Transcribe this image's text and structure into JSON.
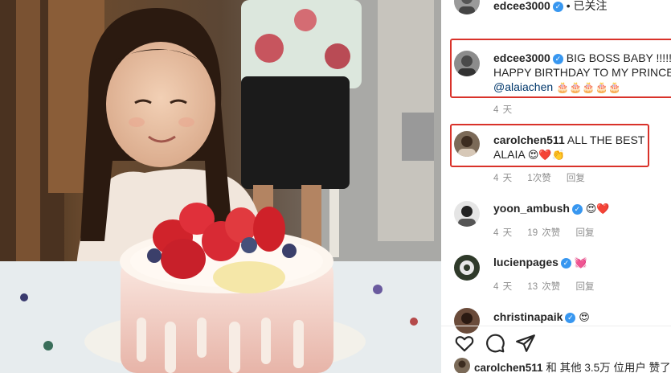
{
  "post": {
    "author": "edcee3000",
    "follow_status": "• 已关注"
  },
  "comments": [
    {
      "username": "edcee3000",
      "line1": "BIG BOSS BABY !!!!!",
      "line2": "HAPPY BIRTHDAY TO MY PRINCESS",
      "mention": "@alaiachen",
      "emojis": "🎂🎂🎂🎂🎂",
      "time": "4 天"
    },
    {
      "username": "carolchen511",
      "line1": "ALL THE BEST",
      "line2": "ALAIA",
      "emojis": "😍❤️👏",
      "time": "4 天",
      "likes": "1次赞",
      "reply": "回复"
    },
    {
      "username": "yoon_ambush",
      "emojis": "😍❤️",
      "time": "4 天",
      "likes": "19 次赞",
      "reply": "回复"
    },
    {
      "username": "lucienpages",
      "emojis": "💓",
      "time": "4 天",
      "likes": "13 次赞",
      "reply": "回复"
    },
    {
      "username": "christinapaik",
      "emojis": "😍"
    }
  ],
  "actions": [
    "heart-icon",
    "comment-icon",
    "share-icon"
  ],
  "liked_by": {
    "user": "carolchen511",
    "text": "和 其他 3.5万 位用户 赞了"
  },
  "colors": {
    "highlight_box": "#d9322a",
    "verified": "#3897f0",
    "mention": "#00376b",
    "meta": "#8e8e8e"
  }
}
